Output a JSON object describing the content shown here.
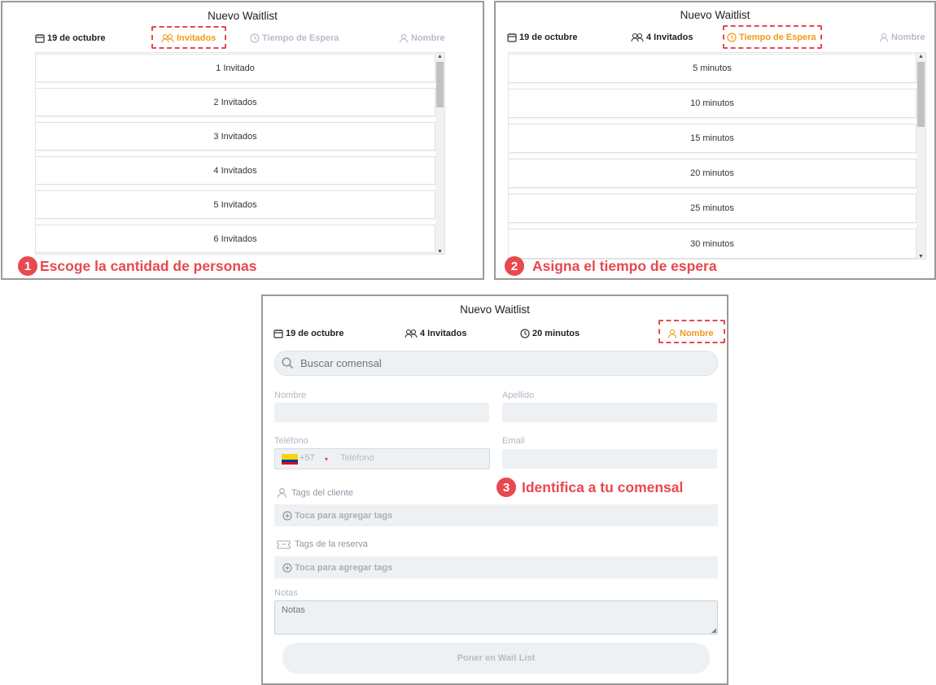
{
  "title": "Nuevo Waitlist",
  "panel1": {
    "tabs": {
      "date": "19 de octubre",
      "guests": "Invitados",
      "wait": "Tiempo de Espera",
      "name": "Nombre"
    },
    "options": [
      "1 Invitado",
      "2 Invitados",
      "3 Invitados",
      "4 Invitados",
      "5 Invitados",
      "6 Invitados"
    ],
    "step_number": "1",
    "step_text": "Escoge la cantidad de personas"
  },
  "panel2": {
    "tabs": {
      "date": "19 de octubre",
      "guests": "4 Invitados",
      "wait": "Tiempo de Espera",
      "name": "Nombre"
    },
    "options": [
      "5 minutos",
      "10 minutos",
      "15 minutos",
      "20 minutos",
      "25 minutos",
      "30 minutos"
    ],
    "step_number": "2",
    "step_text": "Asigna el tiempo de espera"
  },
  "panel3": {
    "tabs": {
      "date": "19 de octubre",
      "guests": "4 Invitados",
      "wait": "20 minutos",
      "name": "Nombre"
    },
    "search_placeholder": "Buscar comensal",
    "labels": {
      "first_name": "Nombre",
      "last_name": "Apellido",
      "phone": "Teléfono",
      "email": "Email",
      "client_tags": "Tags del cliente",
      "reservation_tags": "Tags de la reserva",
      "notes": "Notas"
    },
    "phone_code": "+57",
    "phone_placeholder": "Teléfono",
    "tag_hint": "Toca para agregar tags",
    "notes_placeholder": "Notas",
    "submit_label": "Poner en Wait List",
    "step_number": "3",
    "step_text": "Identifica a tu comensal"
  },
  "colors": {
    "accent": "#f29a19",
    "annotation": "#e8484e",
    "inactive": "#b6bccb",
    "field": "#eef1f3"
  }
}
